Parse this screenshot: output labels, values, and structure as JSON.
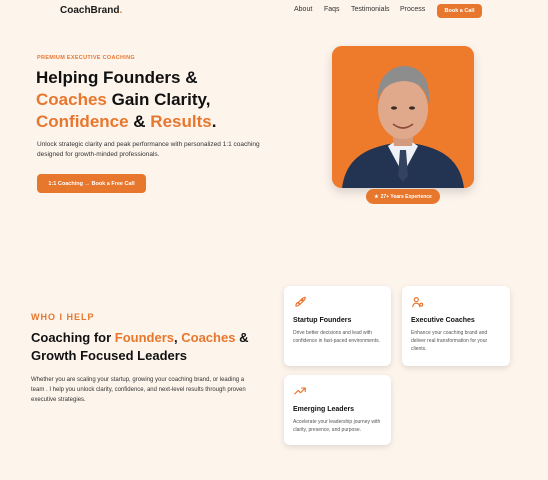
{
  "nav": {
    "logo": "CoachBrand",
    "logo_dot": ".",
    "links": [
      "About",
      "Faqs",
      "Testimonials",
      "Process"
    ],
    "cta": "Book a Call"
  },
  "hero": {
    "eyebrow": "PREMIUM EXECUTIVE COACHING",
    "title_part1": "Helping Founders &",
    "title_coaches": "Coaches",
    "title_part2": " Gain Clarity,",
    "title_confidence": "Confidence",
    "title_amp": " & ",
    "title_results": "Results",
    "title_end": ".",
    "description": "Unlock strategic clarity and peak performance with personalized 1:1 coaching designed for growth-minded professionals.",
    "cta": "1:1 Coaching → Book a Free Call",
    "badge_icon": "★",
    "badge": "27+ Years Experience"
  },
  "who": {
    "label": "WHO I HELP",
    "title_part1": "Coaching for ",
    "title_founders": "Founders",
    "title_comma": ", ",
    "title_coaches": "Coaches",
    "title_part2": " & Growth Focused Leaders",
    "description": "Whether you are scaling your startup, growing your coaching brand, or leading a team . I help you unlock clarity, confidence, and next-level results through proven executive strategies."
  },
  "cards": [
    {
      "icon": "rocket-icon",
      "title": "Startup Founders",
      "desc": "Drive better decisions and lead with confidence in fast-paced environments."
    },
    {
      "icon": "users-icon",
      "title": "Executive Coaches",
      "desc": "Enhance your coaching brand and deliver real transformation for your clients."
    },
    {
      "icon": "trending-up-icon",
      "title": "Emerging Leaders",
      "desc": "Accelerate your leadership journey with clarity, presence, and purpose."
    }
  ],
  "colors": {
    "accent": "#e8772e",
    "background": "#fdf4ec",
    "text": "#111111"
  }
}
